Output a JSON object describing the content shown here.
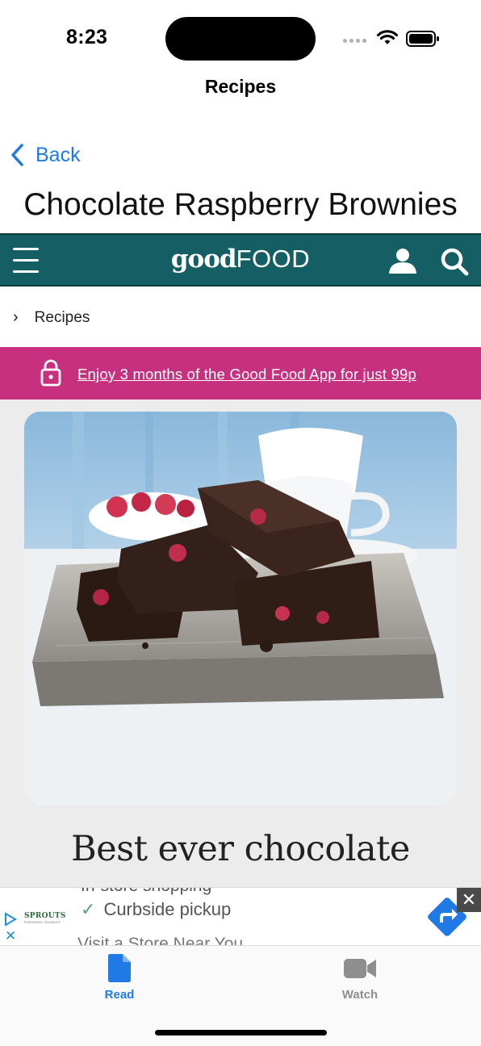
{
  "status_bar": {
    "time": "8:23"
  },
  "nav": {
    "title": "Recipes",
    "back_label": "Back"
  },
  "page": {
    "title": "Chocolate Raspberry Brownies"
  },
  "site_header": {
    "logo_good": "good",
    "logo_food": "FOOD",
    "brand_color": "#155e63"
  },
  "breadcrumb": {
    "label": "Recipes"
  },
  "promo": {
    "text": "Enjoy 3 months of the Good Food App for just 99p",
    "color": "#c7307f"
  },
  "recipe": {
    "heading": "Best ever chocolate"
  },
  "ad": {
    "line_top": "In-store shopping",
    "line_middle": "Curbside pickup",
    "line_bottom": "Visit a Store Near You",
    "brand": "SPROUTS",
    "brand_sub": "FARMERS MARKET",
    "close_label": "✕"
  },
  "tabbar": {
    "items": [
      {
        "label": "Read",
        "icon": "document-icon",
        "active": true
      },
      {
        "label": "Watch",
        "icon": "video-camera-icon",
        "active": false
      }
    ],
    "active_color": "#1f7ae6"
  }
}
